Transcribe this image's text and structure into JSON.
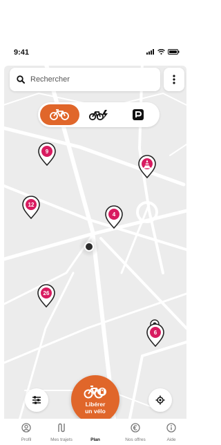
{
  "status_bar": {
    "time": "9:41"
  },
  "search": {
    "placeholder": "Rechercher"
  },
  "mode_toggle": {
    "modes": [
      {
        "icon": "bike-icon",
        "active": true
      },
      {
        "icon": "electric-bike-icon",
        "active": false
      },
      {
        "icon": "parking-icon",
        "active": false
      }
    ]
  },
  "map": {
    "stations": [
      {
        "label": "9",
        "kind": "count"
      },
      {
        "label": "",
        "kind": "construction"
      },
      {
        "label": "12",
        "kind": "count"
      },
      {
        "label": "4",
        "kind": "count"
      },
      {
        "label": "26",
        "kind": "count"
      },
      {
        "label": "6",
        "kind": "count"
      }
    ]
  },
  "unlock_button": {
    "line1": "Libérer",
    "line2": "un vélo"
  },
  "tabs": [
    {
      "label": "Profil",
      "icon": "profile-icon",
      "active": false
    },
    {
      "label": "Mes trajets",
      "icon": "trips-icon",
      "active": false
    },
    {
      "label": "Plan",
      "icon": "map-icon",
      "active": true
    },
    {
      "label": "Nos offres",
      "icon": "euro-icon",
      "active": false
    },
    {
      "label": "Aide",
      "icon": "info-icon",
      "active": false
    }
  ],
  "colors": {
    "accent": "#e0662a",
    "pin": "#d81b60",
    "map_bg": "#ececec"
  }
}
